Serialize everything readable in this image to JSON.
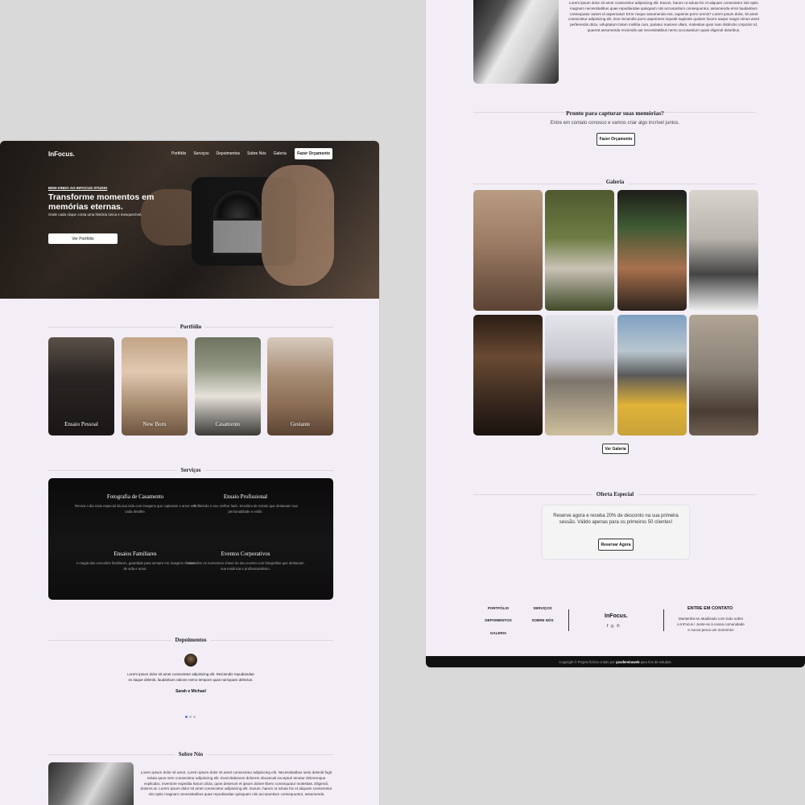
{
  "site": {
    "logo": "InFocus.",
    "nav": [
      "Portfólio",
      "Serviços",
      "Depoimentos",
      "Sobre Nós",
      "Galeria"
    ],
    "nav_cta": "Fazer Orçamento"
  },
  "hero": {
    "eyebrow": "BEM-VINDO AO INFOCUS STUDIO",
    "title": "Transforme momentos em memórias eternas.",
    "lead": "Onde cada clique conta uma história única e inesquecível.",
    "button": "Ver Portfólio"
  },
  "portfolio": {
    "title": "Portfólio",
    "cards": [
      {
        "label": "Ensaio Pessoal",
        "color": "#2a2523"
      },
      {
        "label": "New Born",
        "color": "#a58a6e"
      },
      {
        "label": "Casamento",
        "color": "#6f7460"
      },
      {
        "label": "Gestante",
        "color": "#8b6d55"
      }
    ]
  },
  "services": {
    "title": "Serviços",
    "items": [
      {
        "title": "Fotografia de Casamento",
        "desc": "Reviva o dia mais especial da sua vida com imagens que capturam o amor em cada detalhe."
      },
      {
        "title": "Ensaio Profissional",
        "desc": "Refletindo o seu melhor lado. Sessões de retrato que destacam sua personalidade e estilo."
      },
      {
        "title": "Ensaios Familiares",
        "desc": "A magia das conexões familiares, guardada para sempre em imagens cheias de vida e amor."
      },
      {
        "title": "Eventos Corporativos",
        "desc": "Imortalize os momentos chave do seu evento com fotografias que destacam sua essência e profissionalismo."
      }
    ]
  },
  "testimonials": {
    "title": "Depoimentos",
    "quote": "Lorem ipsum dolor sit amet consectetur adipisicing elit. Reiciendis repudiandae ex itaque deleniti, laudantium ratione nemo tempore quas numquam delectus.",
    "name": "Sarah e Michael"
  },
  "about": {
    "title": "Sobre Nós",
    "text": "Lorem ipsum dolor sit amet, Lorem ipsum dolor sit amet consectetur adipisicing elit. Necessitatibus iusto deleniti fugit soluta quos rem! consectetur adipisicing elit. Exercitationem dolorem obcaecati excepturi tenetur doloremque explicabo, inventore expedita harum dicta, quos deserunt et ipsum dolore libero consequatur molestias. Eligendi, dolores at. Lorem ipsum dolor sit amet consectetur adipisicing elit. Earum, harum ut soluta hic et aliquam consectetur sint optio magnam necessitatibus quae repudiandae quisquam nisi accusantium consequuntur, assumenda",
    "text_right": "Lorem ipsum dolor sit amet consectetur adipisicing elit. Earum, harum ut soluta hic et aliquam consectetur sint optio magnam necessitatibus quae repudiandae quisquam nisi accusantium consequuntur, assumenda error laudantium consequatur autem id aspernatur! Error neque assumenda eos, sapiente porro omnis? Lorem ipsum dolor, sit amet consectetur adipisicing elit. Eos reiciendis porro asperiores impedit sapiente quidem facere saepe magni minus amet perferendis dicta, voluptatum totam mollitia cum, pariatur maiores ullam, molestias quos nam distinctio corporis! Id, quaerat assumenda reiciendis aut necessitatibus nemo accusantium quasi eligendi doloribus."
  },
  "cta": {
    "title": "Pronto para capturar suas memórias?",
    "sub": "Entre em contato conosco e vamos criar algo incrível juntos.",
    "button": "Fazer Orçamento"
  },
  "gallery": {
    "title": "Galeria",
    "button": "Ver Galeria",
    "tiles": [
      {
        "color": "#9a7a63"
      },
      {
        "color": "#5f6d3d"
      },
      {
        "color": "#3e5a32"
      },
      {
        "color": "#b8b4ad"
      },
      {
        "color": "#3a2a20"
      },
      {
        "color": "#a8a49a"
      },
      {
        "color": "#c7a23a"
      },
      {
        "color": "#8a8176"
      }
    ]
  },
  "offer": {
    "title": "Oferta Especial",
    "text": "Reserve agora e receba 20% de desconto na sua primeira sessão. Válido apenas para os primeiros 50 clientes!",
    "button": "Reservar Agora"
  },
  "footer": {
    "links": [
      "PORTFÓLIO",
      "SERVIÇOS",
      "DEPOIMENTOS",
      "SOBRE NÓS",
      "GALERIA"
    ],
    "logo": "InFocus.",
    "icons": [
      "facebook-icon",
      "instagram-icon",
      "whatsapp-icon"
    ],
    "contact_title": "ENTRE EM CONTATO",
    "contact_text": "Mantenha-se atualizado com tudo sobre a InFocus.! Junte-se à nossa comunidade e nunca perca um momento!",
    "copyright_pre": "Copyright © Projeto fictício criado por",
    "copyright_author": "yarafereiraweb",
    "copyright_post": "para fins de estudos."
  }
}
